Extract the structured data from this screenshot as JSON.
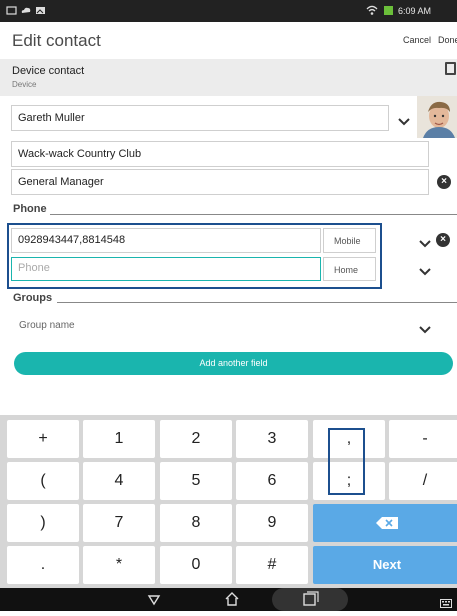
{
  "status_bar": {
    "time": "6:09 AM"
  },
  "app_bar": {
    "title": "Edit contact",
    "cancel_label": "Cancel",
    "done_label": "Done"
  },
  "account": {
    "name": "Device contact",
    "type": "Device"
  },
  "fields": {
    "name": "Gareth Muller",
    "company": "Wack-wack Country Club",
    "title": "General Manager"
  },
  "phone_section": {
    "header": "Phone",
    "entries": [
      {
        "value": "0928943447,8814548",
        "placeholder": "Phone",
        "type": "Mobile"
      },
      {
        "value": "",
        "placeholder": "Phone",
        "type": "Home"
      }
    ]
  },
  "groups_section": {
    "header": "Groups",
    "placeholder": "Group name"
  },
  "add_field_label": "Add another field",
  "keyboard": {
    "rows": [
      [
        "+",
        "1",
        "2",
        "3",
        ",",
        "-"
      ],
      [
        "(",
        "4",
        "5",
        "6",
        ";",
        "/"
      ],
      [
        ")",
        "7",
        "8",
        "9"
      ],
      [
        ".",
        "*",
        "0",
        "#"
      ]
    ],
    "next_label": "Next"
  },
  "colors": {
    "accent": "#1ab5ae",
    "highlight_box": "#1c4f8e",
    "keyboard_action": "#5aa9e6"
  }
}
